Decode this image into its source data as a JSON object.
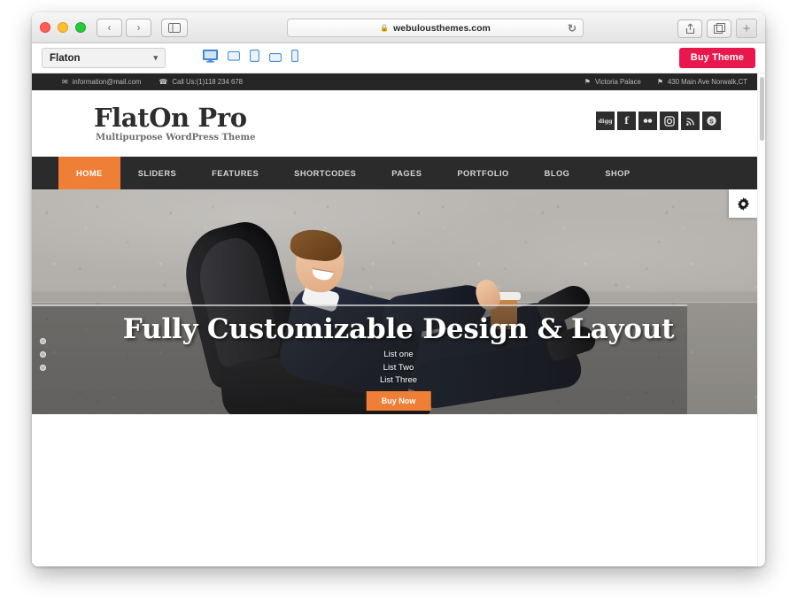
{
  "browser": {
    "traffic_lights": [
      "close",
      "minimize",
      "maximize"
    ],
    "back_label": "‹",
    "forward_label": "›",
    "sidebar_label": "▤",
    "url": "webulousthemes.com",
    "lock_icon": "lock-icon",
    "reload_label": "↻",
    "share_label": "⇧",
    "tabs_label": "⧉",
    "new_tab_label": "+"
  },
  "preview_toolbar": {
    "theme_select_value": "Flaton",
    "chevron": "⌄",
    "devices": [
      {
        "name": "desktop",
        "active": true
      },
      {
        "name": "laptop",
        "active": false
      },
      {
        "name": "tablet-portrait",
        "active": false
      },
      {
        "name": "tablet-landscape",
        "active": false
      },
      {
        "name": "mobile",
        "active": false
      }
    ],
    "buy_theme_label": "Buy Theme",
    "buy_theme_color": "#e8174c"
  },
  "site": {
    "info_bar": {
      "email": "information@mail.com",
      "phone": "Call Us:(1)118 234 678",
      "location_name": "Victoria Palace",
      "address": "430 Main Ave Norwalk,CT",
      "mail_icon": "✉",
      "phone_icon": "✆",
      "pin_icon": "⚑"
    },
    "logo": {
      "title": "FlatOn Pro",
      "tagline": "Multipurpose WordPress Theme"
    },
    "social": [
      {
        "name": "digg",
        "glyph": "digg"
      },
      {
        "name": "facebook",
        "glyph": "f"
      },
      {
        "name": "flickr",
        "glyph": "••"
      },
      {
        "name": "instagram",
        "glyph": "▣"
      },
      {
        "name": "rss",
        "glyph": "⌁"
      },
      {
        "name": "skype",
        "glyph": "S"
      }
    ],
    "nav": [
      {
        "label": "HOME",
        "active": true
      },
      {
        "label": "SLIDERS",
        "active": false
      },
      {
        "label": "FEATURES",
        "active": false
      },
      {
        "label": "SHORTCODES",
        "active": false
      },
      {
        "label": "PAGES",
        "active": false
      },
      {
        "label": "PORTFOLIO",
        "active": false
      },
      {
        "label": "BLOG",
        "active": false
      },
      {
        "label": "SHOP",
        "active": false
      }
    ],
    "hero": {
      "title": "Fully Customizable Design & Layout",
      "list": [
        "List one",
        "List Two",
        "List Three"
      ],
      "cta_label": "Buy Now",
      "slide_count": 3,
      "gear_icon": "gear-icon",
      "accent_color": "#ef7f36"
    }
  }
}
